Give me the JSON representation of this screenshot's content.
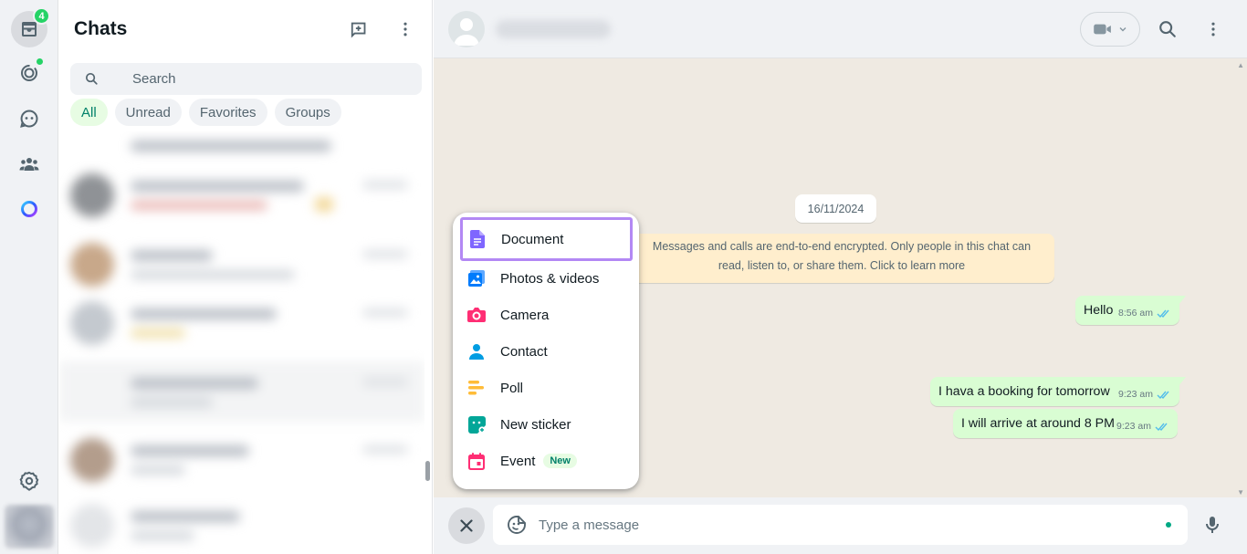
{
  "rail": {
    "chats_badge": "4",
    "icons": [
      "chats-icon",
      "status-icon",
      "channels-icon",
      "communities-icon",
      "meta-ai-icon",
      "settings-icon"
    ]
  },
  "sidebar": {
    "title": "Chats",
    "search_placeholder": "Search",
    "filters": [
      {
        "label": "All",
        "active": true
      },
      {
        "label": "Unread",
        "active": false
      },
      {
        "label": "Favorites",
        "active": false
      },
      {
        "label": "Groups",
        "active": false
      }
    ]
  },
  "conversation": {
    "date_separator": "16/11/2024",
    "encryption_notice": "Messages and calls are end-to-end encrypted. Only people in this chat can read, listen to, or share them. Click to learn more",
    "messages": [
      {
        "text": "Hello",
        "time": "8:56 am",
        "status": "read"
      },
      {
        "text": "I hava a booking for tomorrow",
        "time": "9:23 am",
        "status": "read"
      },
      {
        "text": "I will arrive at around 8 PM",
        "time": "9:23 am",
        "status": "read"
      }
    ],
    "composer_placeholder": "Type a message"
  },
  "attach_menu": {
    "items": [
      {
        "label": "Document",
        "icon": "document-icon",
        "color": "#7f66ff",
        "selected": true
      },
      {
        "label": "Photos & videos",
        "icon": "photos-icon",
        "color": "#007bfc"
      },
      {
        "label": "Camera",
        "icon": "camera-icon",
        "color": "#ff2e74"
      },
      {
        "label": "Contact",
        "icon": "contact-icon",
        "color": "#009de2"
      },
      {
        "label": "Poll",
        "icon": "poll-icon",
        "color": "#ffbc38"
      },
      {
        "label": "New sticker",
        "icon": "sticker-icon",
        "color": "#02a698"
      },
      {
        "label": "Event",
        "icon": "event-icon",
        "color": "#ff2e74",
        "badge": "New"
      }
    ]
  },
  "colors": {
    "accent": "#00a884",
    "outgoing_bubble": "#d9fdd3",
    "chat_bg": "#efeae2",
    "notice_bg": "#ffeecd",
    "highlight_border": "#b388f4"
  }
}
